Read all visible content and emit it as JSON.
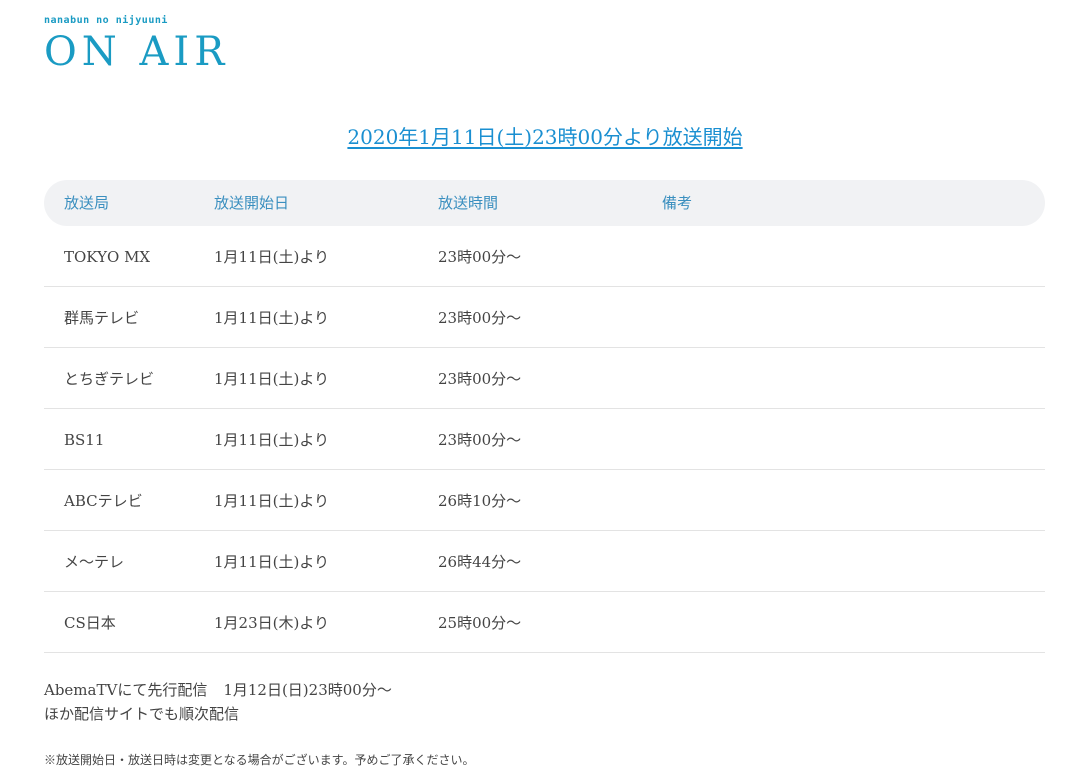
{
  "header": {
    "subtitle": "nanabun no nijyuuni",
    "title": "ON AIR"
  },
  "start_link": "2020年1月11日(土)23時00分より放送開始",
  "table": {
    "columns": [
      "放送局",
      "放送開始日",
      "放送時間",
      "備考"
    ],
    "rows": [
      {
        "station": "TOKYO MX",
        "start": "1月11日(土)より",
        "time": "23時00分〜",
        "note": ""
      },
      {
        "station": "群馬テレビ",
        "start": "1月11日(土)より",
        "time": "23時00分〜",
        "note": ""
      },
      {
        "station": "とちぎテレビ",
        "start": "1月11日(土)より",
        "time": "23時00分〜",
        "note": ""
      },
      {
        "station": "BS11",
        "start": "1月11日(土)より",
        "time": "23時00分〜",
        "note": ""
      },
      {
        "station": "ABCテレビ",
        "start": "1月11日(土)より",
        "time": "26時10分〜",
        "note": ""
      },
      {
        "station": "メ〜テレ",
        "start": "1月11日(土)より",
        "time": "26時44分〜",
        "note": ""
      },
      {
        "station": "CS日本",
        "start": "1月23日(木)より",
        "time": "25時00分〜",
        "note": ""
      }
    ]
  },
  "notes": {
    "line1_label": "AbemaTVにて先行配信",
    "line1_time": "1月12日(日)23時00分〜",
    "line2": "ほか配信サイトでも順次配信"
  },
  "disclaimer": "※放送開始日・放送日時は変更となる場合がございます。予めご了承ください。",
  "colors": {
    "accent": "#1a9bc3",
    "link": "#1a8fd1",
    "header_bg": "#f1f2f4"
  }
}
